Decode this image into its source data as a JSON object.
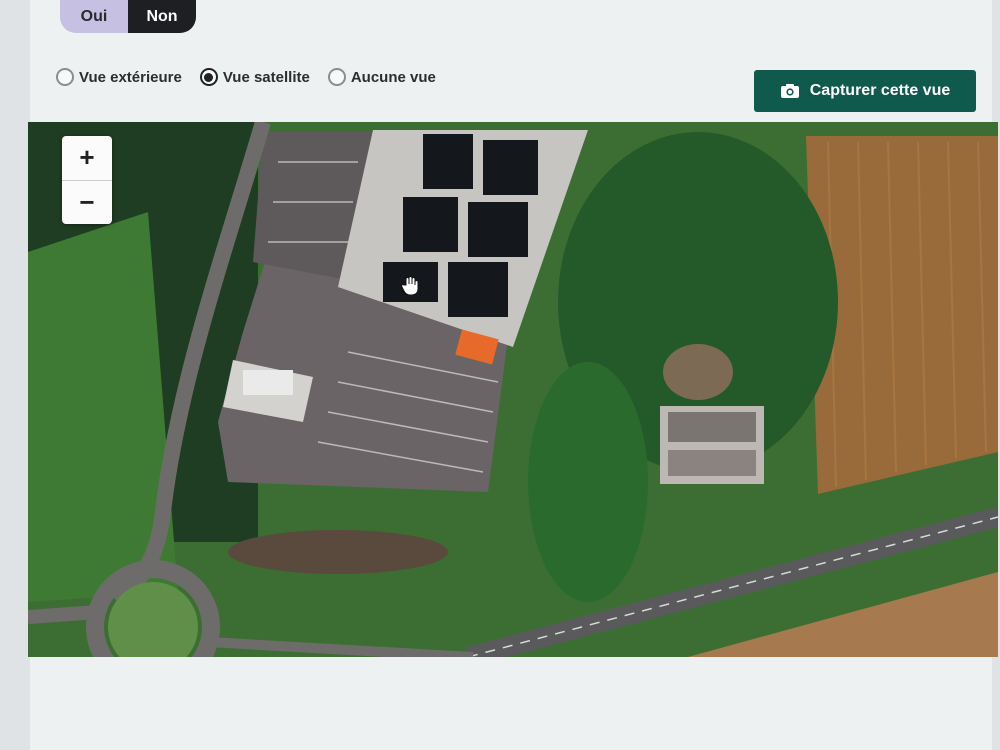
{
  "toggle": {
    "oui_label": "Oui",
    "non_label": "Non",
    "selected": "Non"
  },
  "view_options": [
    {
      "label": "Vue extérieure",
      "checked": false
    },
    {
      "label": "Vue satellite",
      "checked": true
    },
    {
      "label": "Aucune vue",
      "checked": false
    }
  ],
  "capture_button": {
    "label": "Capturer cette vue",
    "icon": "camera-icon"
  },
  "map": {
    "zoom_in_label": "+",
    "zoom_out_label": "−",
    "cursor_icon": "hand-grab-icon",
    "colors": {
      "field": "#9a6b3a",
      "trees": "#2f6a2c",
      "grass": "#4f8a3c",
      "road": "#5a5a5c",
      "parking": "#6a6466",
      "building_roof": "#1a1c1f"
    }
  }
}
